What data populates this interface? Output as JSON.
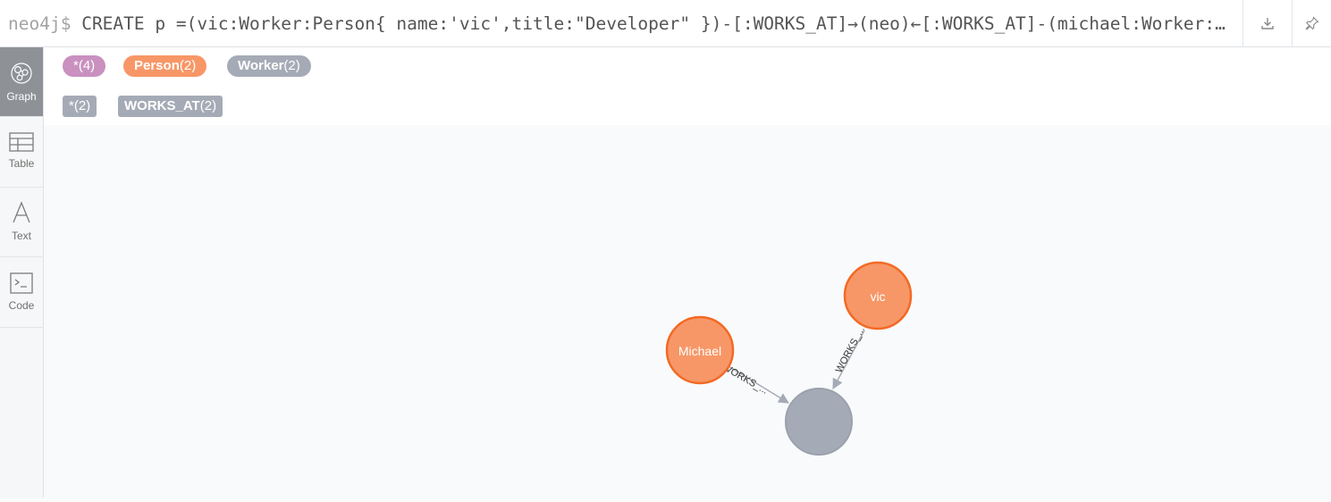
{
  "query": {
    "prompt": "neo4j$",
    "text": "CREATE p =(vic:Worker:Person{ name:'vic',title:\"Developer\" })-[:WORKS_AT]→(neo)←[:WORKS_AT]-(michael:Worker:Person{ name:'Michael',title:\"Manager\" }) RETURN p"
  },
  "toolbar": {
    "download_icon": "download-icon",
    "pin_icon": "pin-icon"
  },
  "sidebar": {
    "items": [
      {
        "label": "Graph",
        "icon": "graph-icon",
        "active": true
      },
      {
        "label": "Table",
        "icon": "table-icon"
      },
      {
        "label": "Text",
        "icon": "text-icon"
      },
      {
        "label": "Code",
        "icon": "code-icon"
      }
    ]
  },
  "legend": {
    "labels": [
      {
        "name": "*",
        "count": "(4)",
        "color": "#c990c0"
      },
      {
        "name": "Person",
        "count": "(2)",
        "color": "#f79767"
      },
      {
        "name": "Worker",
        "count": "(2)",
        "color": "#a5abb6"
      }
    ],
    "relationships": [
      {
        "name": "*",
        "count": "(2)",
        "color": "#a5abb6"
      },
      {
        "name": "WORKS_AT",
        "count": "(2)",
        "color": "#a5abb6"
      }
    ]
  },
  "graph": {
    "nodes": [
      {
        "id": "vic",
        "caption": "vic",
        "color": "#f79767",
        "border": "#f36924"
      },
      {
        "id": "michael",
        "caption": "Michael",
        "color": "#f79767",
        "border": "#f36924"
      },
      {
        "id": "neo",
        "caption": "",
        "color": "#a5abb6",
        "border": "#9aa1ac"
      }
    ],
    "relationships": [
      {
        "from": "michael",
        "to": "neo",
        "caption": "WORKS_..."
      },
      {
        "from": "vic",
        "to": "neo",
        "caption": "WORKS_..."
      }
    ]
  }
}
